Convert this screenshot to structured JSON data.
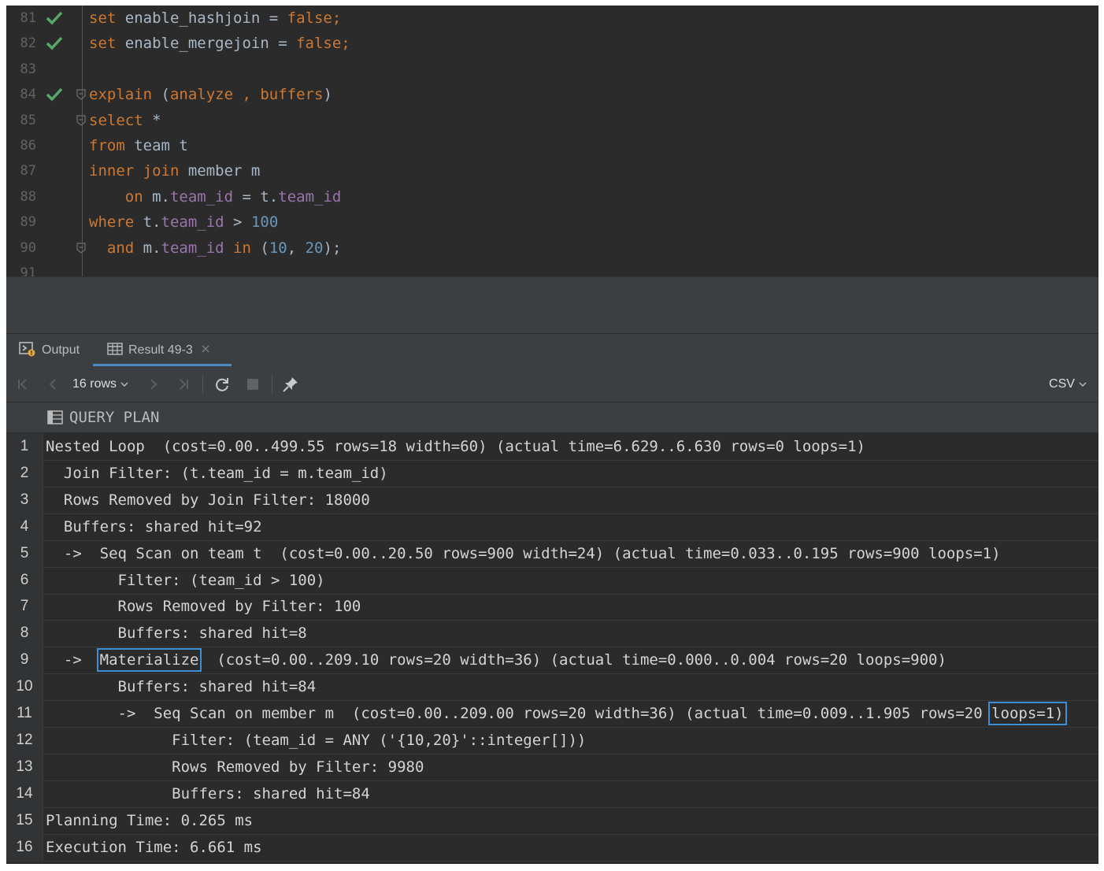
{
  "editor": {
    "lines": [
      {
        "num": "81",
        "checked": true,
        "fold": false,
        "tokens": [
          {
            "t": "set ",
            "c": "kw"
          },
          {
            "t": "enable_hashjoin = ",
            "c": "plain"
          },
          {
            "t": "false;",
            "c": "kw"
          }
        ]
      },
      {
        "num": "82",
        "checked": true,
        "fold": false,
        "tokens": [
          {
            "t": "set ",
            "c": "kw"
          },
          {
            "t": "enable_mergejoin = ",
            "c": "plain"
          },
          {
            "t": "false;",
            "c": "kw"
          }
        ]
      },
      {
        "num": "83",
        "checked": false,
        "fold": false,
        "tokens": []
      },
      {
        "num": "84",
        "checked": true,
        "fold": true,
        "tokens": [
          {
            "t": "explain ",
            "c": "kw"
          },
          {
            "t": "(",
            "c": "plain"
          },
          {
            "t": "analyze , buffers",
            "c": "kw"
          },
          {
            "t": ")",
            "c": "plain"
          }
        ]
      },
      {
        "num": "85",
        "checked": false,
        "fold": true,
        "tokens": [
          {
            "t": "select ",
            "c": "kw"
          },
          {
            "t": "*",
            "c": "plain"
          }
        ]
      },
      {
        "num": "86",
        "checked": false,
        "fold": false,
        "tokens": [
          {
            "t": "from ",
            "c": "kw"
          },
          {
            "t": "team t",
            "c": "plain"
          }
        ]
      },
      {
        "num": "87",
        "checked": false,
        "fold": false,
        "tokens": [
          {
            "t": "inner join ",
            "c": "kw"
          },
          {
            "t": "member m",
            "c": "plain"
          }
        ]
      },
      {
        "num": "88",
        "checked": false,
        "fold": false,
        "tokens": [
          {
            "t": "    on ",
            "c": "kw"
          },
          {
            "t": "m.",
            "c": "plain"
          },
          {
            "t": "team_id",
            "c": "fld"
          },
          {
            "t": " = t.",
            "c": "plain"
          },
          {
            "t": "team_id",
            "c": "fld"
          }
        ]
      },
      {
        "num": "89",
        "checked": false,
        "fold": false,
        "tokens": [
          {
            "t": "where ",
            "c": "kw"
          },
          {
            "t": "t.",
            "c": "plain"
          },
          {
            "t": "team_id",
            "c": "fld"
          },
          {
            "t": " > ",
            "c": "plain"
          },
          {
            "t": "100",
            "c": "num"
          }
        ]
      },
      {
        "num": "90",
        "checked": false,
        "fold": true,
        "tokens": [
          {
            "t": "  and ",
            "c": "kw"
          },
          {
            "t": "m.",
            "c": "plain"
          },
          {
            "t": "team_id",
            "c": "fld"
          },
          {
            "t": " in ",
            "c": "kw"
          },
          {
            "t": "(",
            "c": "plain"
          },
          {
            "t": "10",
            "c": "num"
          },
          {
            "t": ", ",
            "c": "plain"
          },
          {
            "t": "20",
            "c": "num"
          },
          {
            "t": ");",
            "c": "plain"
          }
        ]
      },
      {
        "num": "91",
        "checked": false,
        "fold": false,
        "tokens": []
      }
    ]
  },
  "tabs": {
    "output_label": "Output",
    "result_label": "Result 49-3"
  },
  "toolbar": {
    "rows_label": "16 rows",
    "export_label": "CSV"
  },
  "grid": {
    "column_header": "QUERY PLAN",
    "rows": [
      {
        "n": "1",
        "text": "Nested Loop  (cost=0.00..499.55 rows=18 width=60) (actual time=6.629..6.630 rows=0 loops=1)"
      },
      {
        "n": "2",
        "text": "  Join Filter: (t.team_id = m.team_id)"
      },
      {
        "n": "3",
        "text": "  Rows Removed by Join Filter: 18000"
      },
      {
        "n": "4",
        "text": "  Buffers: shared hit=92"
      },
      {
        "n": "5",
        "text": "  ->  Seq Scan on team t  (cost=0.00..20.50 rows=900 width=24) (actual time=0.033..0.195 rows=900 loops=1)"
      },
      {
        "n": "6",
        "text": "        Filter: (team_id > 100)"
      },
      {
        "n": "7",
        "text": "        Rows Removed by Filter: 100"
      },
      {
        "n": "8",
        "text": "        Buffers: shared hit=8"
      },
      {
        "n": "9",
        "pre": "  ->  ",
        "hl": "Materialize",
        "post": "  (cost=0.00..209.10 rows=20 width=36) (actual time=0.000..0.004 rows=20 loops=900)"
      },
      {
        "n": "10",
        "text": "        Buffers: shared hit=84"
      },
      {
        "n": "11",
        "pre": "        ->  Seq Scan on member m  (cost=0.00..209.00 rows=20 width=36) (actual time=0.009..1.905 rows=20 ",
        "hl": "loops=1)",
        "post": ""
      },
      {
        "n": "12",
        "text": "              Filter: (team_id = ANY ('{10,20}'::integer[]))"
      },
      {
        "n": "13",
        "text": "              Rows Removed by Filter: 9980"
      },
      {
        "n": "14",
        "text": "              Buffers: shared hit=84"
      },
      {
        "n": "15",
        "text": "Planning Time: 0.265 ms"
      },
      {
        "n": "16",
        "text": "Execution Time: 6.661 ms"
      }
    ]
  },
  "colors": {
    "keyword": "#cc7832",
    "field": "#9876aa",
    "number": "#6897bb",
    "check": "#59a869",
    "highlight_box": "#3c8fd6"
  }
}
